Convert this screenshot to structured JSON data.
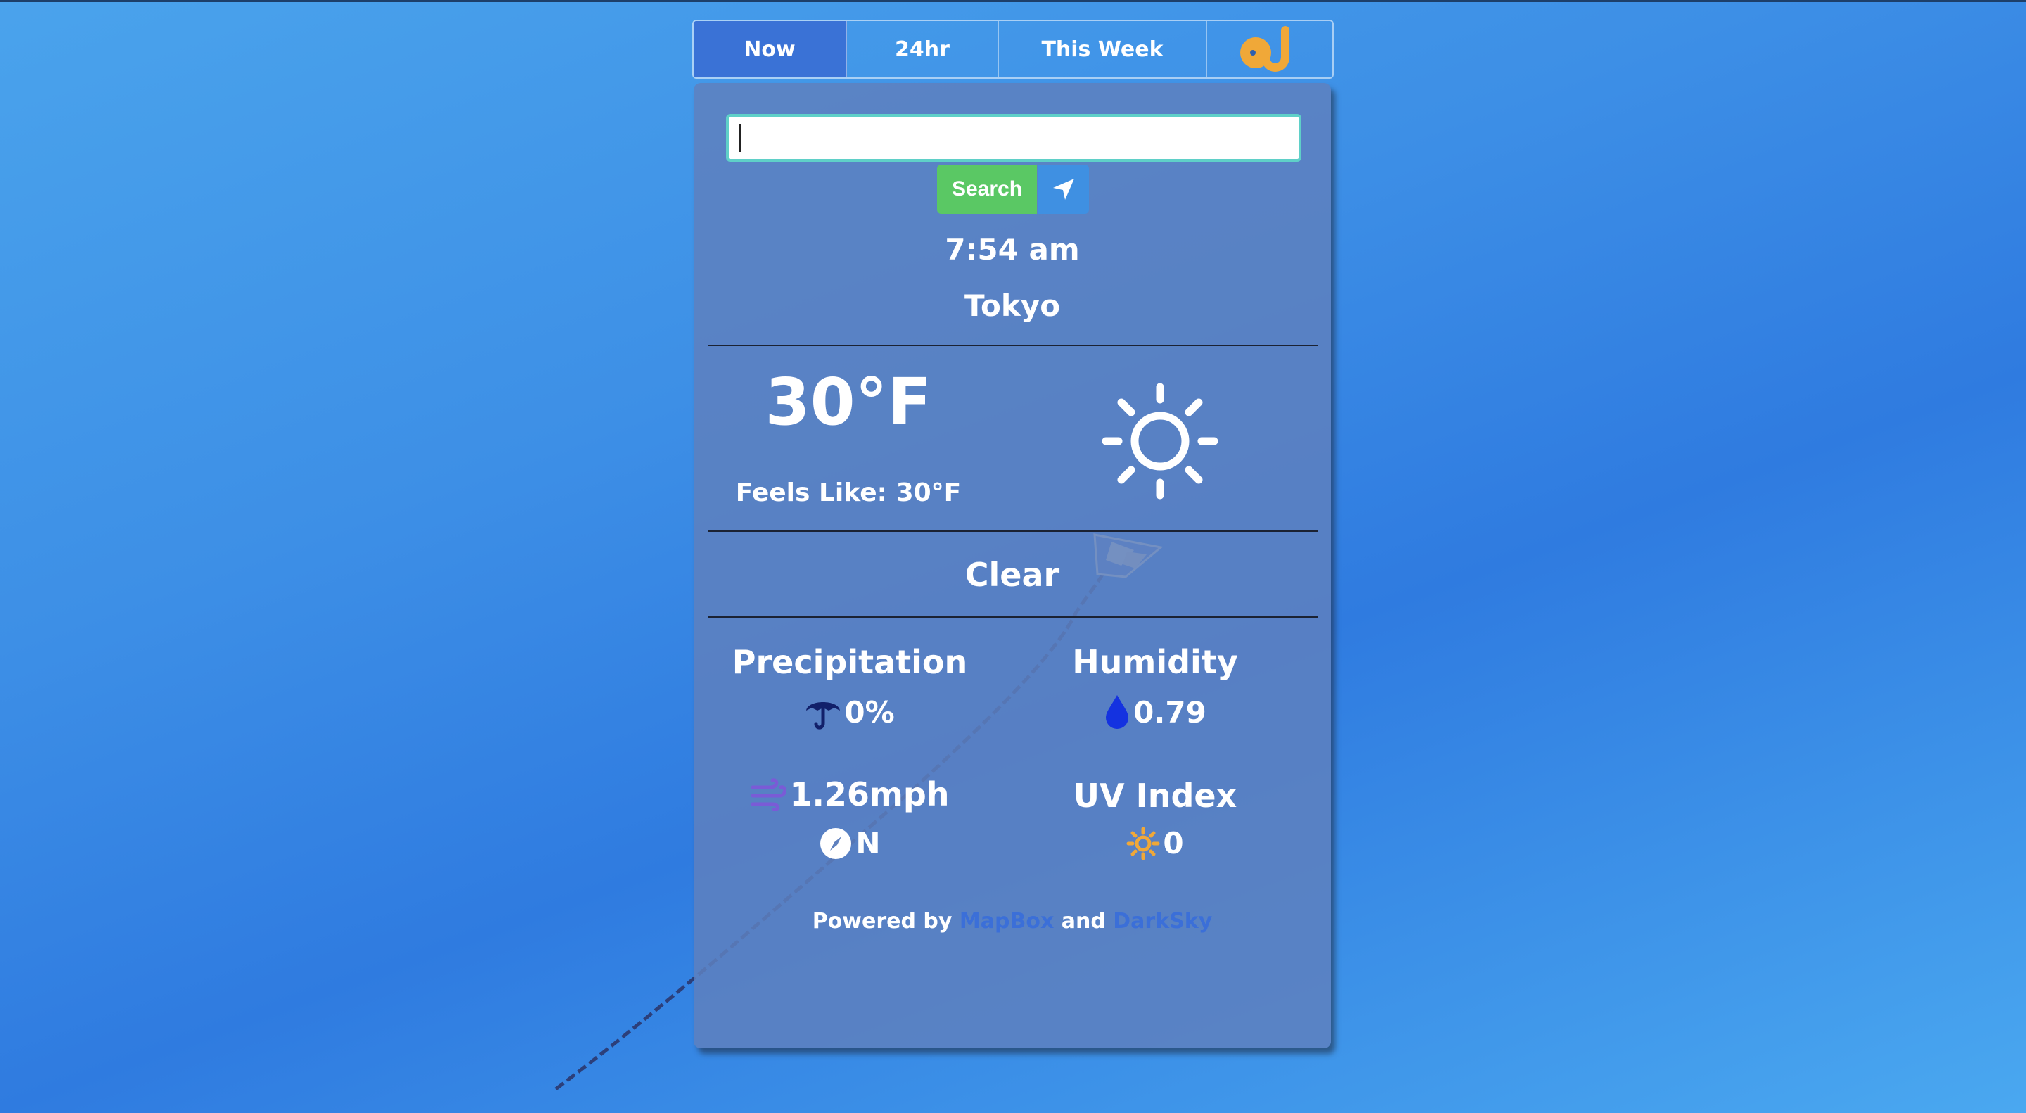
{
  "tabs": [
    {
      "label": "Now",
      "active": true
    },
    {
      "label": "24hr",
      "active": false
    },
    {
      "label": "This Week",
      "active": false
    }
  ],
  "logo": {
    "icon": "oj-logo-icon",
    "color": "#f0a838"
  },
  "search": {
    "value": "",
    "placeholder": "",
    "button_label": "Search",
    "locate_icon": "location-arrow-icon"
  },
  "current": {
    "time": "7:54 am",
    "city": "Tokyo",
    "temperature": "30°F",
    "feels_like": "Feels Like: 30°F",
    "condition_icon": "sun-icon",
    "condition": "Clear"
  },
  "stats": {
    "precipitation": {
      "title": "Precipitation",
      "value": "0%",
      "icon": "umbrella-icon"
    },
    "humidity": {
      "title": "Humidity",
      "value": "0.79",
      "icon": "water-drop-icon"
    },
    "wind": {
      "speed": "1.26mph",
      "direction": "N",
      "icon": "wind-icon",
      "direction_icon": "compass-icon"
    },
    "uv": {
      "title": "UV Index",
      "value": "0",
      "icon": "uv-sun-icon"
    }
  },
  "footer": {
    "prefix": "Powered by",
    "link1": "MapBox",
    "and": "and",
    "link2": "DarkSky"
  },
  "colors": {
    "accent": "#3a72d6",
    "search_button": "#5ac864",
    "locate_button": "#3f90e2",
    "link": "#3b6fd8",
    "uv_icon": "#f0a838"
  }
}
